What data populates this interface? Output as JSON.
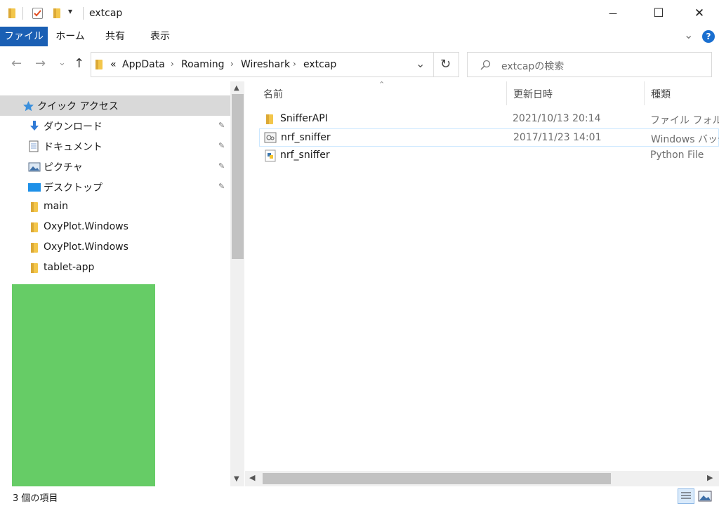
{
  "window": {
    "title": "extcap",
    "quick_access_dropdown": "▾",
    "minimize": "—",
    "maximize": "☐",
    "close": "✕"
  },
  "ribbon": {
    "tabs": [
      "ファイル",
      "ホーム",
      "共有",
      "表示"
    ],
    "expand": "⌄",
    "help": "?"
  },
  "navbar": {
    "back": "←",
    "forward": "→",
    "recent": "⌄",
    "up": "↑",
    "overflow": "«",
    "crumbs": [
      "AppData",
      "Roaming",
      "Wireshark",
      "extcap"
    ],
    "dropdown": "⌄",
    "refresh": "↻",
    "search_placeholder": "extcapの検索"
  },
  "navpane": {
    "items": [
      {
        "label": "クイック アクセス",
        "icon": "star-icon"
      },
      {
        "label": "ダウンロード",
        "icon": "download-icon",
        "pinned": true
      },
      {
        "label": "ドキュメント",
        "icon": "document-icon",
        "pinned": true
      },
      {
        "label": "ピクチャ",
        "icon": "picture-icon",
        "pinned": true
      },
      {
        "label": "デスクトップ",
        "icon": "desktop-icon",
        "pinned": true
      },
      {
        "label": "main",
        "icon": "folder-icon"
      },
      {
        "label": "OxyPlot.Windows",
        "icon": "folder-icon"
      },
      {
        "label": "OxyPlot.Windows",
        "icon": "folder-icon"
      },
      {
        "label": "tablet-app",
        "icon": "folder-icon"
      }
    ],
    "pin_glyph": "📌",
    "block_color": "#66cc66"
  },
  "filelist": {
    "headers": [
      "名前",
      "更新日時",
      "種類"
    ],
    "sort_glyph": "⌃",
    "rows": [
      {
        "name": "SnifferAPI",
        "date": "2021/10/13 20:14",
        "type": "ファイル フォルダー",
        "icon": "folder-icon"
      },
      {
        "name": "nrf_sniffer",
        "date": "2017/11/23 14:01",
        "type": "Windows バッチ",
        "icon": "batch-file-icon"
      },
      {
        "name": "nrf_sniffer",
        "date": "",
        "type": "Python File",
        "icon": "python-file-icon"
      }
    ]
  },
  "status": {
    "count": "3 個の項目"
  },
  "colors": {
    "accent": "#1a5fb4",
    "selection_border": "#cce8ff"
  }
}
